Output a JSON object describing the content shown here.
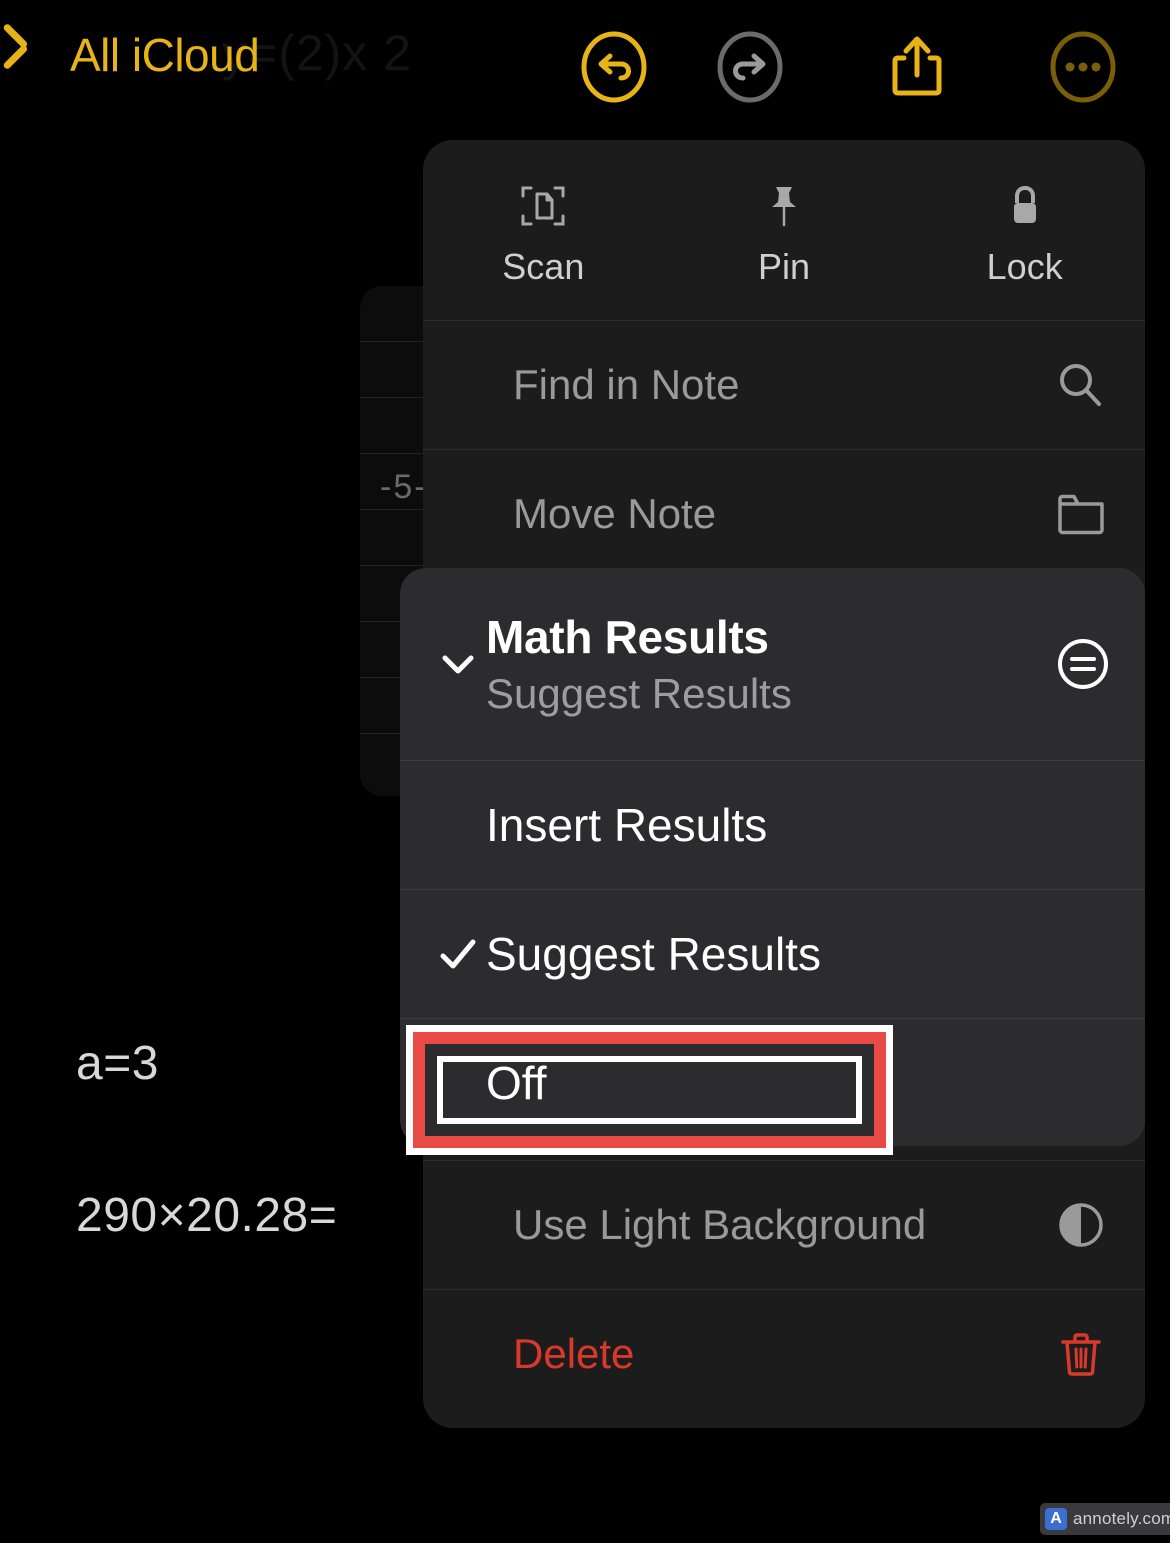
{
  "app": "Apple Notes",
  "toolbar": {
    "back_label": "All iCloud",
    "back_icon": "chevron-left-icon",
    "undo_icon": "undo-icon",
    "redo_icon": "redo-icon",
    "share_icon": "share-icon",
    "more_icon": "more-ellipsis-icon",
    "accent_color": "#E8B317",
    "undo_color": "#E8B317",
    "redo_color": "#6b6b6b",
    "share_color": "#E8B317",
    "more_color": "#7a5e0a"
  },
  "background_note": {
    "ghost_text": "y=(2)x 2",
    "lines": [
      "a=3",
      "290×20.28="
    ],
    "tick_label": "-5-"
  },
  "menu": {
    "quick_actions": [
      {
        "label": "Scan",
        "icon": "document-scan-icon"
      },
      {
        "label": "Pin",
        "icon": "pushpin-icon"
      },
      {
        "label": "Lock",
        "icon": "lock-icon"
      }
    ],
    "rows": [
      {
        "label": "Find in Note",
        "icon": "search-icon",
        "style": "normal"
      },
      {
        "label": "Move Note",
        "icon": "folder-icon",
        "style": "normal"
      },
      {
        "label": "Use Light Background",
        "icon": "half-circle-icon",
        "style": "normal"
      },
      {
        "label": "Delete",
        "icon": "trash-icon",
        "style": "danger"
      }
    ]
  },
  "submenu": {
    "title": "Math Results",
    "subtitle": "Suggest Results",
    "header_icon": "equals-circle-icon",
    "collapse_icon": "chevron-down-icon",
    "items": [
      {
        "label": "Insert Results",
        "checked": false
      },
      {
        "label": "Suggest Results",
        "checked": true
      },
      {
        "label": "Off",
        "checked": false,
        "highlighted": true
      }
    ]
  },
  "annotation": {
    "target_label": "Off",
    "border_color": "#E94A45",
    "outline_color": "#FFFFFF"
  },
  "watermark": {
    "badge": "A",
    "text": "annotely.com"
  }
}
